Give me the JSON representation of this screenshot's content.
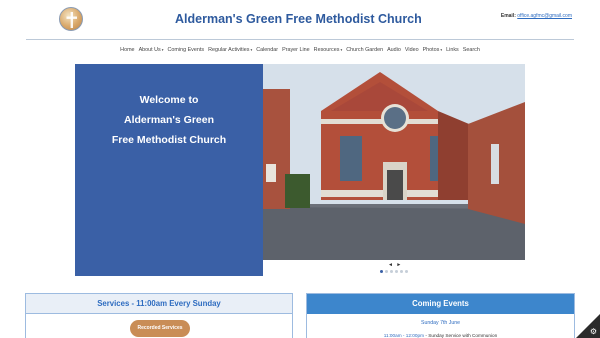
{
  "header": {
    "title": "Alderman's Green Free Methodist Church",
    "email_label": "Email:",
    "email_value": "office.agfmc@gmail.com",
    "logo_icon": "cross-logo-icon"
  },
  "nav": {
    "items": [
      {
        "label": "Home",
        "dropdown": false
      },
      {
        "label": "About Us",
        "dropdown": true
      },
      {
        "label": "Coming Events",
        "dropdown": false
      },
      {
        "label": "Regular Activities",
        "dropdown": true
      },
      {
        "label": "Calendar",
        "dropdown": false
      },
      {
        "label": "Prayer Line",
        "dropdown": false
      },
      {
        "label": "Resources",
        "dropdown": true
      },
      {
        "label": "Church Garden",
        "dropdown": false
      },
      {
        "label": "Audio",
        "dropdown": false
      },
      {
        "label": "Video",
        "dropdown": false
      },
      {
        "label": "Photos",
        "dropdown": true
      },
      {
        "label": "Links",
        "dropdown": false
      },
      {
        "label": "Search",
        "dropdown": false
      }
    ]
  },
  "hero": {
    "welcome_lines": [
      "Welcome to",
      "Alderman's Green",
      "Free Methodist Church"
    ],
    "slider_arrows": "◄ ►",
    "slide_count": 6,
    "active_slide": 1
  },
  "services": {
    "title": "Services - 11:00am Every Sunday",
    "button_label": "Recorded Services"
  },
  "events": {
    "title": "Coming Events",
    "date": "Sunday 7th June",
    "time": "11:00am - 12:00pm",
    "description": " - Sunday Service with Communion"
  },
  "colors": {
    "brand_blue": "#3a60a6",
    "title_blue": "#2e5a9e",
    "events_header": "#3d86cc",
    "button_tan": "#c98d56"
  },
  "corner_icon": "gear-icon"
}
